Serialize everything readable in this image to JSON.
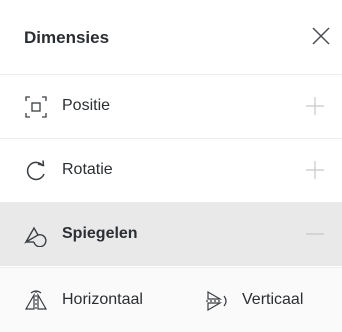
{
  "panel": {
    "title": "Dimensies",
    "close_icon": "close-icon"
  },
  "rows": [
    {
      "label": "Positie",
      "icon": "position-icon",
      "action": "plus-icon",
      "expanded": false
    },
    {
      "label": "Rotatie",
      "icon": "rotate-icon",
      "action": "plus-icon",
      "expanded": false
    },
    {
      "label": "Spiegelen",
      "icon": "mirror-icon",
      "action": "minus-icon",
      "expanded": true
    }
  ],
  "mirror_options": [
    {
      "label": "Horizontaal",
      "icon": "flip-horizontal-icon"
    },
    {
      "label": "Verticaal",
      "icon": "flip-vertical-icon"
    }
  ],
  "colors": {
    "text": "#2b2f33",
    "expanded_bg": "#e9e9ea",
    "muted_icon": "#c8c8c8"
  }
}
